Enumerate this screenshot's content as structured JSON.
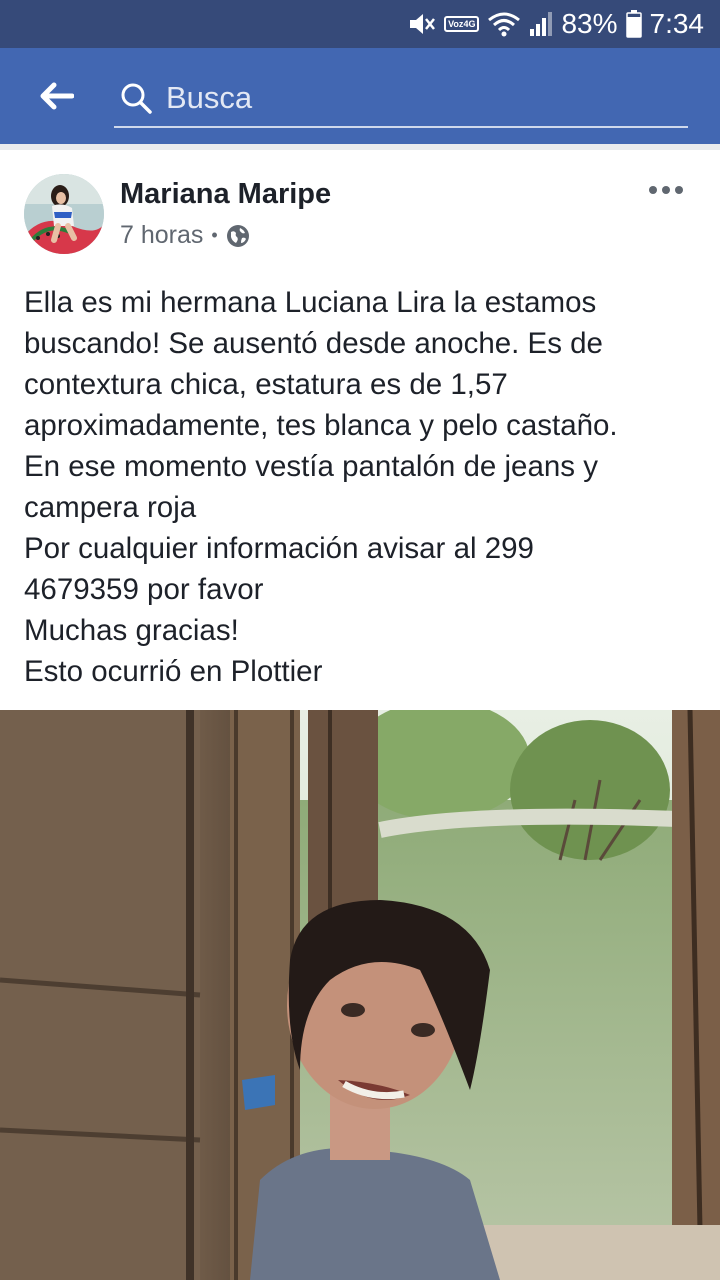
{
  "status_bar": {
    "volte_top": "Voz",
    "volte_bottom": "4G",
    "battery": "83%",
    "time": "7:34",
    "icons": [
      "mute-icon",
      "volte-icon",
      "wifi-icon",
      "signal-icon",
      "battery-icon"
    ]
  },
  "app_bar": {
    "search_placeholder": "Busca",
    "back_icon": "back-arrow-icon",
    "search_icon": "search-icon",
    "color": "#4267b2"
  },
  "post": {
    "author": "Mariana Maripe",
    "time": "7 horas",
    "separator": "•",
    "privacy_icon": "globe-icon",
    "more_icon": "more-horizontal-icon",
    "text_lines": [
      "Ella es mi hermana Luciana Lira la estamos",
      "buscando! Se ausentó desde anoche. Es de",
      "contextura chica, estatura es de 1,57",
      "aproximadamente, tes blanca y pelo castaño.",
      "En ese momento vestía pantalón de jeans y",
      "campera roja",
      "Por cualquier información avisar al 299",
      "4679359 por favor",
      "Muchas gracias!",
      "Esto ocurrió en Plottier"
    ]
  },
  "colors": {
    "status_bar": "#364a79",
    "app_bar": "#4267b2",
    "text_primary": "#1d2129",
    "text_secondary": "#606770"
  }
}
